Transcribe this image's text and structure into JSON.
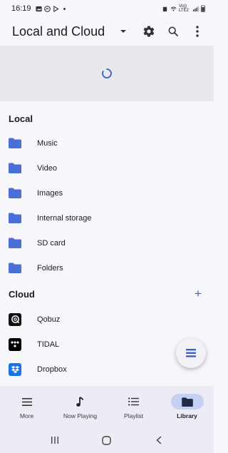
{
  "status_bar": {
    "time": "16:19",
    "network_label": "Vo)) LTE2",
    "left_icons": [
      "image-icon",
      "messenger-icon",
      "play-store-icon",
      "dot-icon"
    ],
    "right_icons": [
      "alarm-icon",
      "wifi-icon",
      "signal-icon",
      "battery-icon"
    ]
  },
  "app_bar": {
    "title": "Local and Cloud",
    "actions": [
      "settings-icon",
      "search-icon",
      "more-vert-icon"
    ]
  },
  "local_section": {
    "header": "Local",
    "items": [
      {
        "label": "Music",
        "icon": "folder-icon"
      },
      {
        "label": "Video",
        "icon": "folder-icon"
      },
      {
        "label": "Images",
        "icon": "folder-icon"
      },
      {
        "label": "Internal storage",
        "icon": "folder-icon"
      },
      {
        "label": "SD card",
        "icon": "folder-icon"
      },
      {
        "label": "Folders",
        "icon": "folder-icon"
      }
    ]
  },
  "cloud_section": {
    "header": "Cloud",
    "add_label": "+",
    "items": [
      {
        "label": "Qobuz",
        "icon": "qobuz-icon"
      },
      {
        "label": "TIDAL",
        "icon": "tidal-icon"
      },
      {
        "label": "Dropbox",
        "icon": "dropbox-icon"
      }
    ]
  },
  "bottom_nav": {
    "items": [
      {
        "label": "More",
        "icon": "menu-icon",
        "active": false
      },
      {
        "label": "Now Playing",
        "icon": "music-note-icon",
        "active": false
      },
      {
        "label": "Playlist",
        "icon": "playlist-icon",
        "active": false
      },
      {
        "label": "Library",
        "icon": "folder-icon",
        "active": true
      }
    ]
  },
  "colors": {
    "accent": "#3a5fc7",
    "folder": "#4a6fd6",
    "active_nav_pill": "#c5d1f4",
    "loading_panel": "#e9e8ee",
    "background": "#f7f6fb"
  }
}
